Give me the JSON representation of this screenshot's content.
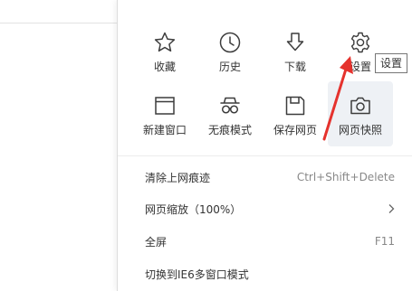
{
  "menu": {
    "tiles": [
      {
        "label": "收藏",
        "icon": "star-icon"
      },
      {
        "label": "历史",
        "icon": "clock-icon"
      },
      {
        "label": "下载",
        "icon": "download-icon"
      },
      {
        "label": "设置",
        "icon": "gear-icon"
      },
      {
        "label": "新建窗口",
        "icon": "window-icon"
      },
      {
        "label": "无痕模式",
        "icon": "incognito-icon"
      },
      {
        "label": "保存网页",
        "icon": "save-icon"
      },
      {
        "label": "网页快照",
        "icon": "camera-icon"
      }
    ],
    "items": [
      {
        "label": "清除上网痕迹",
        "shortcut": "Ctrl+Shift+Delete"
      },
      {
        "label": "网页缩放（100%）",
        "shortcut": ""
      },
      {
        "label": "全屏",
        "shortcut": "F11"
      },
      {
        "label": "切换到IE6多窗口模式",
        "shortcut": ""
      }
    ]
  },
  "tooltip": {
    "text": "设置"
  },
  "colors": {
    "icon": "#3c3c3c",
    "highlight_bg": "#eef1f5",
    "annotation_arrow": "#e5322d",
    "tooltip_border": "#767676"
  }
}
